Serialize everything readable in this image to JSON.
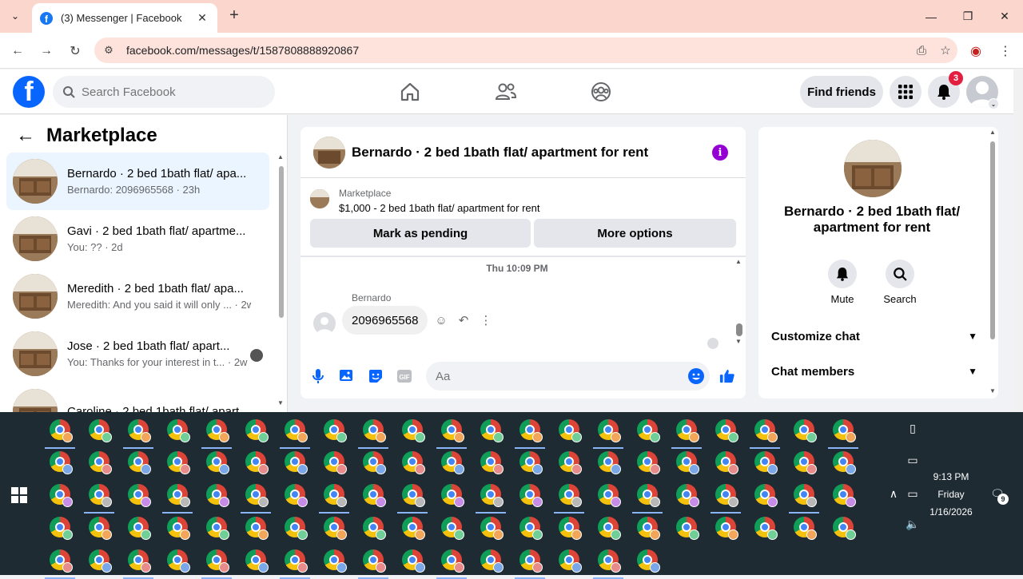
{
  "browser": {
    "tab_title": "(3) Messenger | Facebook",
    "url": "facebook.com/messages/t/1587808888920867",
    "accent": "#fbd6cc"
  },
  "fb": {
    "logo": "f",
    "search_placeholder": "Search Facebook",
    "find_friends": "Find friends",
    "notification_count": "3"
  },
  "left": {
    "title": "Marketplace",
    "conversations": [
      {
        "name": "Bernardo · 2 bed 1bath flat/ apa...",
        "preview": "Bernardo: 2096965568 · 23h"
      },
      {
        "name": "Gavi · 2 bed 1bath flat/ apartme...",
        "preview": "You: ?? · 2d"
      },
      {
        "name": "Meredith · 2 bed 1bath flat/ apa...",
        "preview": "Meredith: And you said it will only ... · 2w"
      },
      {
        "name": "Jose · 2 bed 1bath flat/ apart...",
        "preview": "You: Thanks for your interest in t... · 2w"
      },
      {
        "name": "Caroline · 2 bed 1bath flat/ apart...",
        "preview": ""
      }
    ]
  },
  "chat": {
    "header_name": "Bernardo · 2 bed 1bath flat/ apartment for rent",
    "marketplace_label": "Marketplace",
    "listing": "$1,000 - 2 bed 1bath flat/ apartment for rent",
    "mark_pending": "Mark as pending",
    "more_options": "More options",
    "timestamp": "Thu 10:09 PM",
    "sender": "Bernardo",
    "message": "2096965568",
    "input_placeholder": "Aa"
  },
  "right": {
    "name": "Bernardo · 2 bed 1bath flat/ apartment for rent",
    "mute": "Mute",
    "search": "Search",
    "customize": "Customize chat",
    "members": "Chat members"
  },
  "taskbar": {
    "time": "9:13 PM",
    "day": "Friday",
    "date": "1/16/2026",
    "notif_count": "9"
  }
}
